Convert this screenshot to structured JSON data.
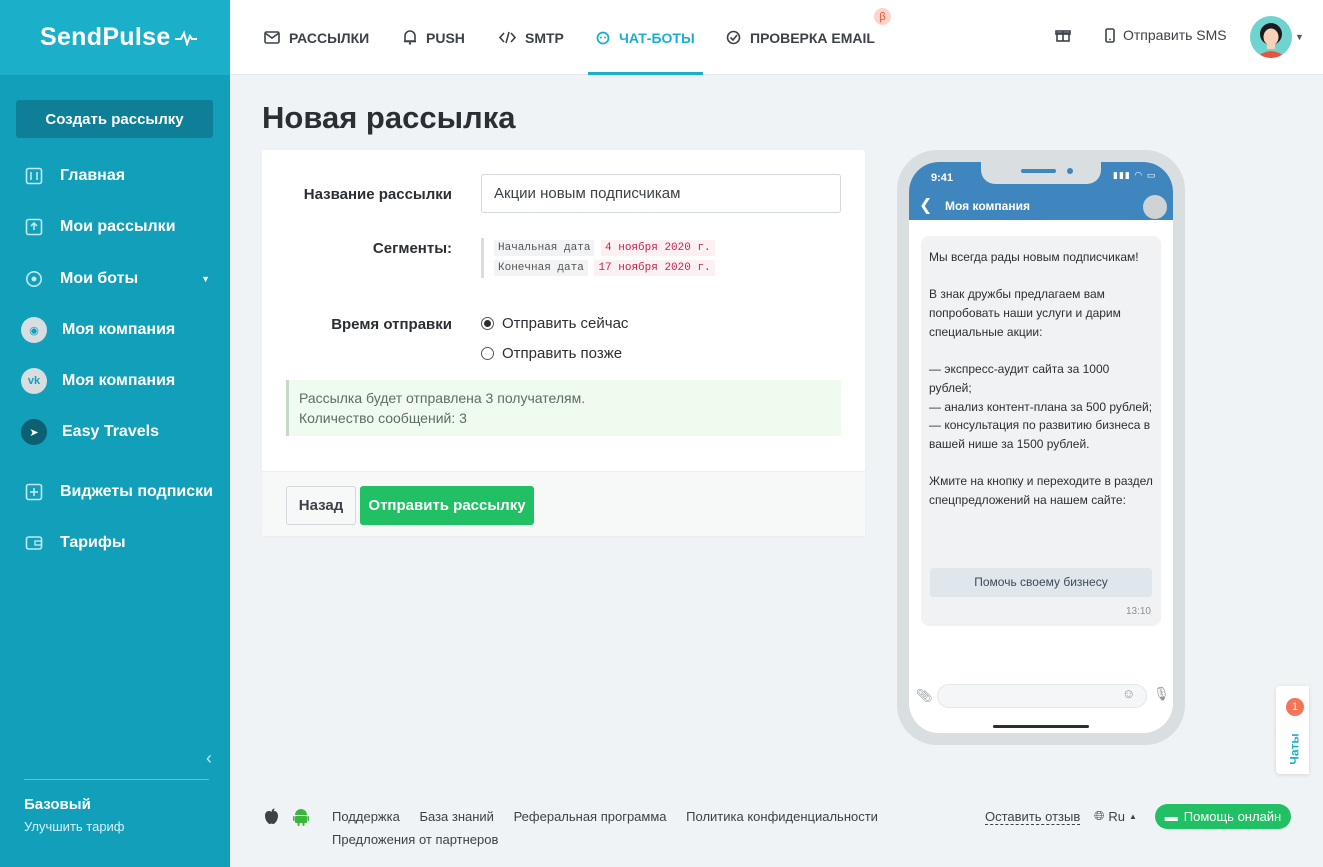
{
  "brand": {
    "logo_text": "SendPulse"
  },
  "sidebar": {
    "create_button": "Создать рассылку",
    "items": [
      {
        "label": "Главная",
        "icon": "dashboard-icon"
      },
      {
        "label": "Мои рассылки",
        "icon": "upload-icon"
      },
      {
        "label": "Мои боты",
        "icon": "bot-icon"
      },
      {
        "label": "Моя компания",
        "icon": "messenger-icon"
      },
      {
        "label": "Моя компания",
        "icon": "vk-icon"
      },
      {
        "label": "Easy Travels",
        "icon": "telegram-icon"
      },
      {
        "label": "Виджеты подписки",
        "icon": "widget-icon"
      },
      {
        "label": "Тарифы",
        "icon": "wallet-icon"
      }
    ],
    "plan_name": "Базовый",
    "plan_upgrade": "Улучшить тариф"
  },
  "topbar": {
    "tabs": [
      {
        "label": "РАССЫЛКИ",
        "icon": "mail-icon"
      },
      {
        "label": "PUSH",
        "icon": "bell-icon"
      },
      {
        "label": "SMTP",
        "icon": "code-icon"
      },
      {
        "label": "ЧАТ-БОТЫ",
        "icon": "chatbot-icon"
      },
      {
        "label": "ПРОВЕРКА EMAIL",
        "icon": "check-circle-icon"
      }
    ],
    "beta_badge": "β",
    "sms_label": "Отправить SMS"
  },
  "page": {
    "title": "Новая рассылка",
    "form": {
      "name_label": "Название рассылки",
      "name_value": "Акции новым подписчикам",
      "segments_label": "Сегменты:",
      "segments": [
        {
          "key": "Начальная дата",
          "value": "4 ноября 2020 г."
        },
        {
          "key": "Конечная дата",
          "value": "17 ноября 2020 г."
        }
      ],
      "send_time_label": "Время отправки",
      "send_now": "Отправить сейчас",
      "send_later": "Отправить позже",
      "info_line1": "Рассылка будет отправлена 3 получателям.",
      "info_line2": "Количество сообщений: 3",
      "back_button": "Назад",
      "send_button": "Отправить рассылку"
    }
  },
  "preview": {
    "time": "9:41",
    "company": "Моя компания",
    "message": "Мы всегда рады новым подписчикам!\n\nВ знак дружбы предлагаем вам попробовать наши услуги и дарим специальные акции:\n\n— экспресс-аудит сайта за 1000 рублей;\n— анализ контент-плана за 500 рублей;\n— консультация по развитию бизнеса в вашей нише за 1500 рублей.\n\nЖмите на кнопку и переходите в раздел спецпредложений на нашем сайте:",
    "button": "Помочь своему бизнесу",
    "msg_time": "13:10"
  },
  "chats_tab": {
    "label": "Чаты",
    "badge": "1"
  },
  "footer": {
    "links": [
      "Поддержка",
      "База знаний",
      "Реферальная программа",
      "Политика конфиденциальности"
    ],
    "partners": "Предложения от партнеров",
    "feedback": "Оставить отзыв",
    "lang": "Ru",
    "help": "Помощь онлайн"
  },
  "colors": {
    "accent": "#1bb0c9",
    "sidebar": "#129fba",
    "success": "#22c065"
  }
}
